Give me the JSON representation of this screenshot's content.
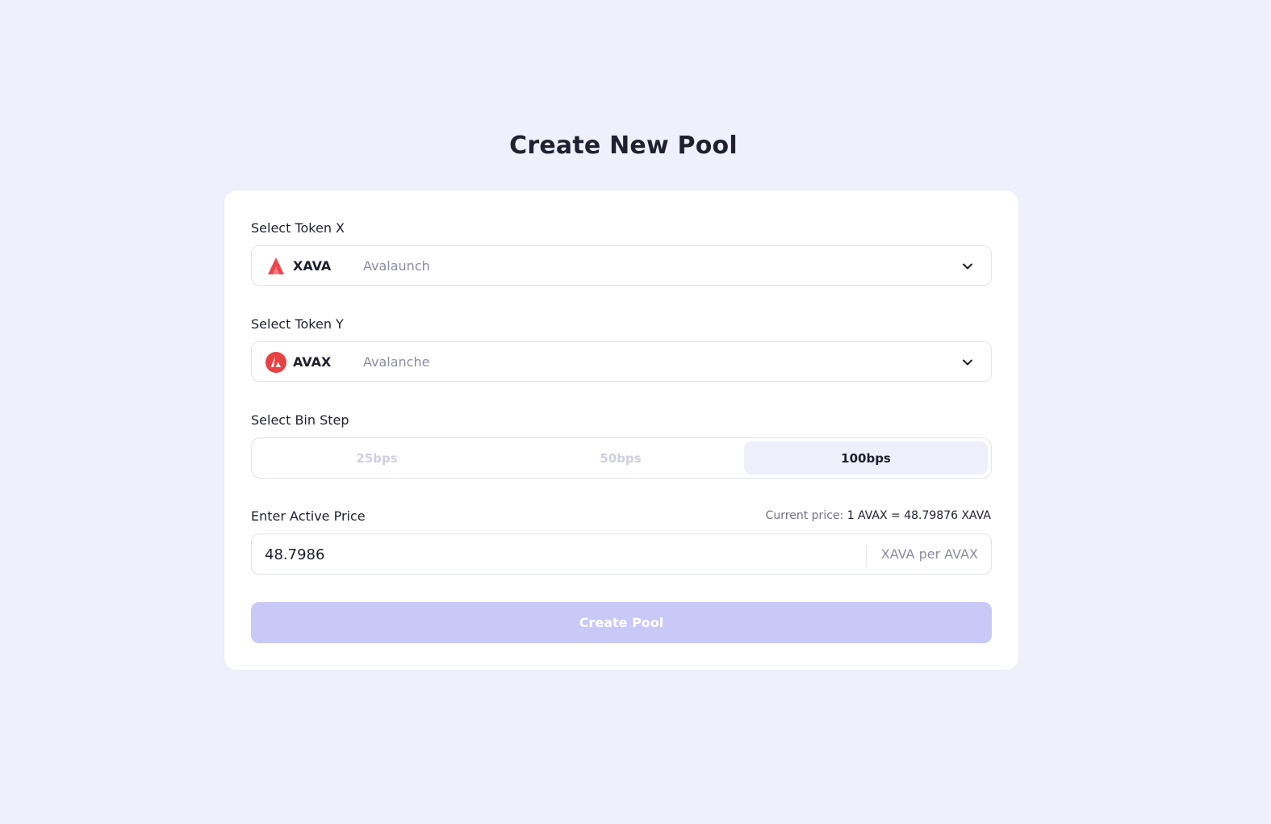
{
  "page": {
    "title": "Create New Pool",
    "background": "#f0f0fd"
  },
  "token_x": {
    "label": "Select Token X",
    "symbol": "XAVA",
    "name": "Avalaunch",
    "icon": "avalaunch-logo-icon",
    "icon_color": "#f0464f"
  },
  "token_y": {
    "label": "Select Token Y",
    "symbol": "AVAX",
    "name": "Avalanche",
    "icon": "avalanche-logo-icon",
    "icon_color": "#e84142"
  },
  "bin_step": {
    "label": "Select Bin Step",
    "options": [
      "25bps",
      "50bps",
      "100bps"
    ],
    "selected": "100bps"
  },
  "active_price": {
    "label": "Enter Active Price",
    "current_price_prefix": "Current price:",
    "current_price_value": "1 AVAX = 48.79876 XAVA",
    "value": "48.7986",
    "unit": "XAVA per AVAX"
  },
  "create_button": {
    "label": "Create Pool",
    "color": "#c9c9f8"
  }
}
